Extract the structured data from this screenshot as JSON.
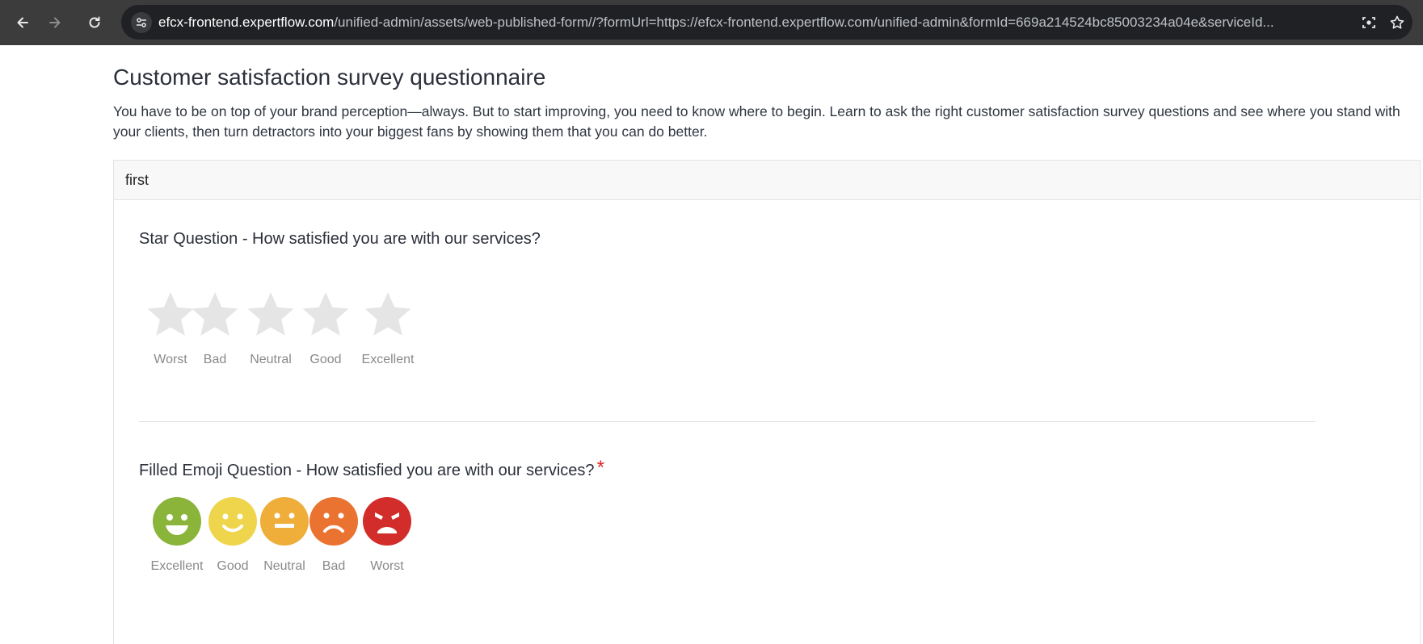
{
  "browser": {
    "url_host": "efcx-frontend.expertflow.com",
    "url_rest": "/unified-admin/assets/web-published-form//?formUrl=https://efcx-frontend.expertflow.com/unified-admin&formId=669a214524bc85003234a04e&serviceId..."
  },
  "page": {
    "title": "Customer satisfaction survey questionnaire",
    "description": "You have to be on top of your brand perception—always. But to start improving, you need to know where to begin. Learn to ask the right customer satisfaction survey questions and see where you stand with your clients, then turn detractors into your biggest fans by showing them that you can do better."
  },
  "section": {
    "title": "first"
  },
  "star_question": {
    "title": "Star Question - How satisfied you are with our services?",
    "options": [
      {
        "label": "Worst"
      },
      {
        "label": "Bad"
      },
      {
        "label": "Neutral"
      },
      {
        "label": "Good"
      },
      {
        "label": "Excellent"
      }
    ],
    "star_color": "#e5e5e5"
  },
  "emoji_question": {
    "title": "Filled Emoji Question - How satisfied you are with our services?",
    "required_mark": "*",
    "options": [
      {
        "label": "Excellent",
        "color": "#8ab43a",
        "icon": "grin-face-icon"
      },
      {
        "label": "Good",
        "color": "#efd54b",
        "icon": "smile-face-icon"
      },
      {
        "label": "Neutral",
        "color": "#efad3a",
        "icon": "neutral-face-icon"
      },
      {
        "label": "Bad",
        "color": "#ea7331",
        "icon": "frown-face-icon"
      },
      {
        "label": "Worst",
        "color": "#d22d2a",
        "icon": "angry-face-icon"
      }
    ]
  }
}
